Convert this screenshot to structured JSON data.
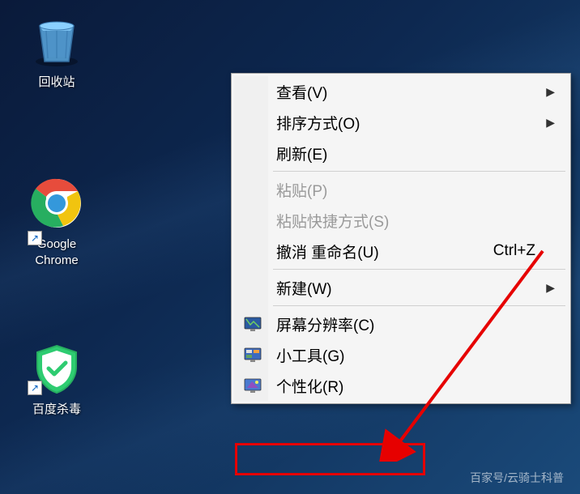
{
  "desktop": {
    "recycle_bin": {
      "label": "回收站"
    },
    "chrome": {
      "label_line1": "Google",
      "label_line2": "Chrome"
    },
    "baidu_av": {
      "label": "百度杀毒"
    }
  },
  "context_menu": {
    "view": {
      "label": "查看(V)",
      "has_submenu": true
    },
    "sort": {
      "label": "排序方式(O)",
      "has_submenu": true
    },
    "refresh": {
      "label": "刷新(E)"
    },
    "paste": {
      "label": "粘贴(P)",
      "disabled": true
    },
    "paste_shortcut": {
      "label": "粘贴快捷方式(S)",
      "disabled": true
    },
    "undo_rename": {
      "label": "撤消 重命名(U)",
      "shortcut": "Ctrl+Z"
    },
    "new": {
      "label": "新建(W)",
      "has_submenu": true
    },
    "screen_resolution": {
      "label": "屏幕分辨率(C)"
    },
    "gadgets": {
      "label": "小工具(G)"
    },
    "personalize": {
      "label": "个性化(R)"
    }
  },
  "watermark": "百家号/云骑士科普"
}
